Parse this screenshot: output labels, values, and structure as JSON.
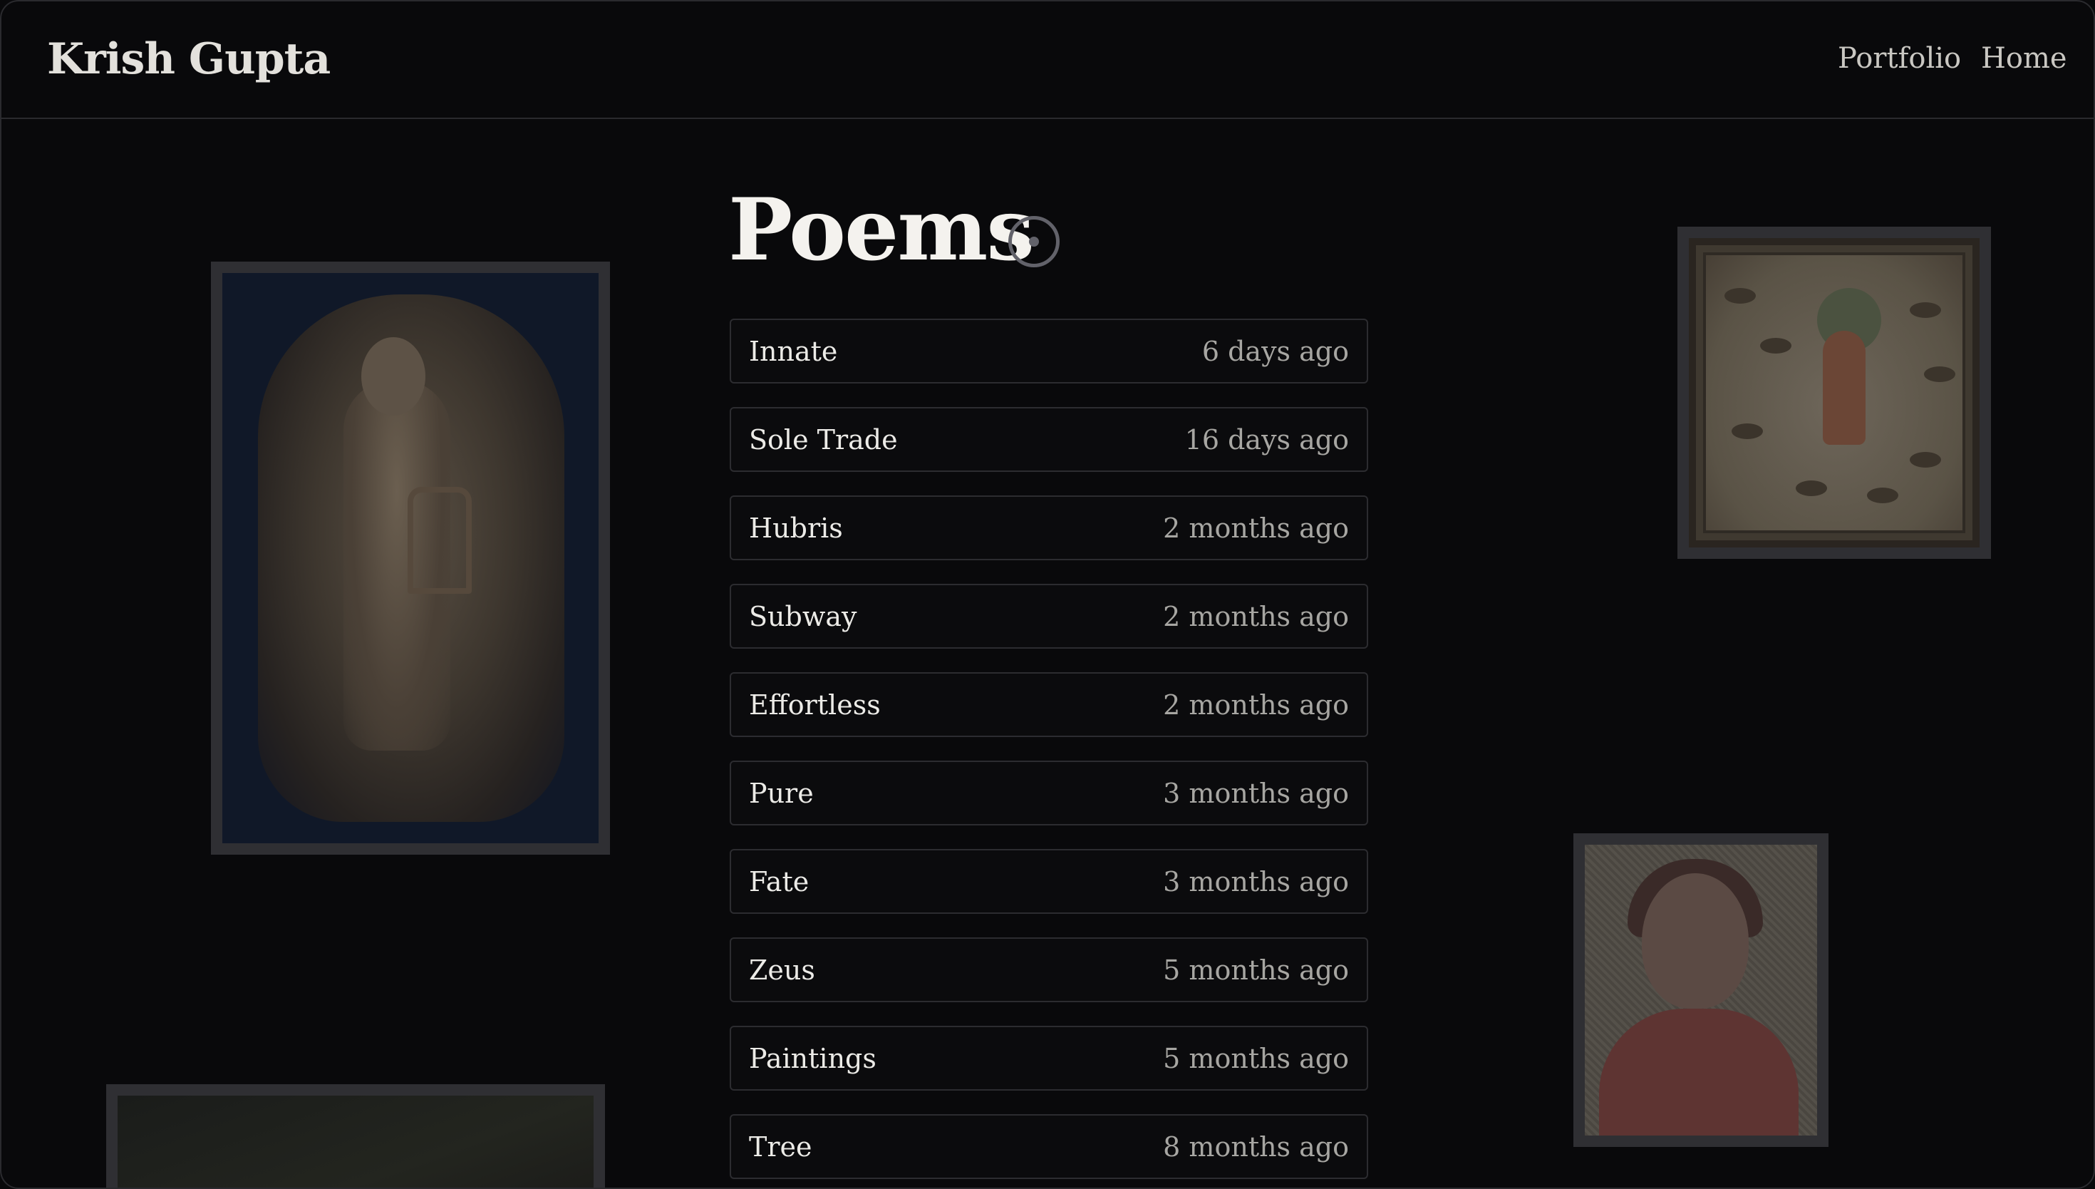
{
  "header": {
    "brand": "Krish Gupta",
    "nav": [
      {
        "label": "Portfolio"
      },
      {
        "label": "Home"
      }
    ]
  },
  "main": {
    "title": "Poems",
    "title_icon": "circle-dot-icon",
    "poems": [
      {
        "title": "Innate",
        "date": "6 days ago"
      },
      {
        "title": "Sole Trade",
        "date": "16 days ago"
      },
      {
        "title": "Hubris",
        "date": "2 months ago"
      },
      {
        "title": "Subway",
        "date": "2 months ago"
      },
      {
        "title": "Effortless",
        "date": "2 months ago"
      },
      {
        "title": "Pure",
        "date": "3 months ago"
      },
      {
        "title": "Fate",
        "date": "3 months ago"
      },
      {
        "title": "Zeus",
        "date": "5 months ago"
      },
      {
        "title": "Paintings",
        "date": "5 months ago"
      },
      {
        "title": "Tree",
        "date": "8 months ago"
      }
    ]
  },
  "colors": {
    "background": "#09090b",
    "text": "#ecebe7",
    "muted": "#a7a6a2",
    "border": "#2c2c30"
  }
}
